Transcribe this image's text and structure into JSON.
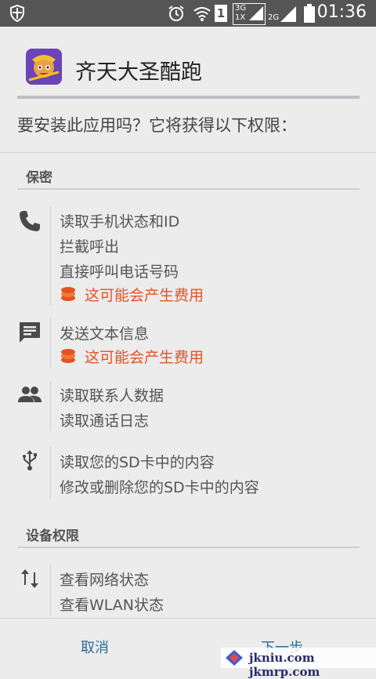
{
  "status_bar": {
    "time": "01:36",
    "network_1": "3G",
    "network_2": "1X",
    "network_3": "2G",
    "sim_slot": "1"
  },
  "app": {
    "name": "齐天大圣酷跑"
  },
  "prompt": "要安装此应用吗？它将获得以下权限：",
  "sections": [
    {
      "title": "保密",
      "groups": [
        {
          "icon": "phone-icon",
          "lines": [
            "读取手机状态和ID",
            "拦截呼出",
            "直接呼叫电话号码"
          ],
          "cost_warning": "这可能会产生费用"
        },
        {
          "icon": "message-icon",
          "lines": [
            "发送文本信息"
          ],
          "cost_warning": "这可能会产生费用"
        },
        {
          "icon": "contacts-icon",
          "lines": [
            "读取联系人数据",
            "读取通话日志"
          ]
        },
        {
          "icon": "usb-icon",
          "lines": [
            "读取您的SD卡中的内容",
            "修改或删除您的SD卡中的内容"
          ]
        }
      ]
    },
    {
      "title": "设备权限",
      "groups": [
        {
          "icon": "network-arrows-icon",
          "lines": [
            "查看网络状态",
            "查看WLAN状态"
          ]
        }
      ]
    }
  ],
  "buttons": {
    "cancel": "取消",
    "next": "下一步"
  },
  "watermark": "jkniu.com jkmrp.com",
  "colors": {
    "status_bar_bg": "#555555",
    "background": "#ececec",
    "cost_warning": "#e5531f",
    "button_text": "#2d6a9a"
  }
}
